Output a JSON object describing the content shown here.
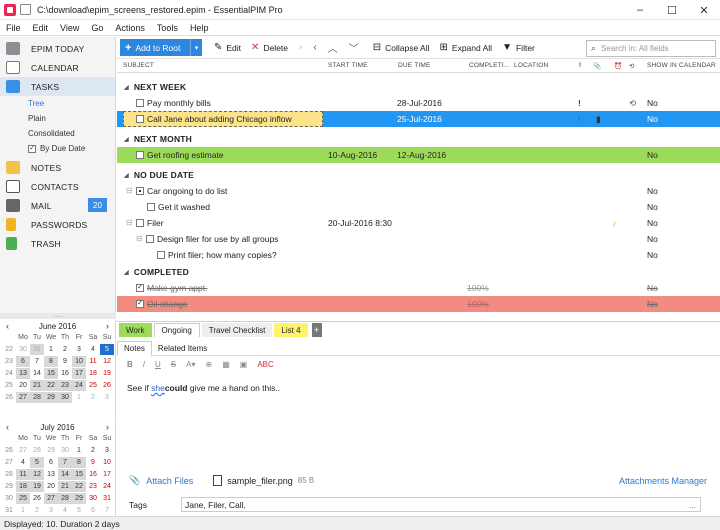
{
  "window": {
    "title": "C:\\download\\epim_screens_restored.epim - EssentialPIM Pro"
  },
  "menu": [
    "File",
    "Edit",
    "View",
    "Go",
    "Actions",
    "Tools",
    "Help"
  ],
  "sidebar": {
    "items": [
      {
        "label": "EPIM TODAY",
        "icon": "home-icon"
      },
      {
        "label": "CALENDAR",
        "icon": "calendar-icon"
      },
      {
        "label": "TASKS",
        "icon": "tasks-icon",
        "active": true
      },
      {
        "label": "NOTES",
        "icon": "notes-icon"
      },
      {
        "label": "CONTACTS",
        "icon": "contacts-icon"
      },
      {
        "label": "MAIL",
        "icon": "mail-icon",
        "badge": "20"
      },
      {
        "label": "PASSWORDS",
        "icon": "key-icon"
      },
      {
        "label": "TRASH",
        "icon": "trash-icon"
      }
    ],
    "task_views": [
      "Tree",
      "Plain",
      "Consolidated"
    ],
    "by_due_date": "By Due Date"
  },
  "calendar_june": {
    "title": "June  2016",
    "dayheads": [
      "Mo",
      "Tu",
      "We",
      "Th",
      "Fr",
      "Sa",
      "Su"
    ],
    "weeks": [
      {
        "wk": "22",
        "days": [
          "30",
          "31",
          "1",
          "2",
          "3",
          "4",
          "5"
        ]
      },
      {
        "wk": "23",
        "days": [
          "6",
          "7",
          "8",
          "9",
          "10",
          "11",
          "12"
        ]
      },
      {
        "wk": "24",
        "days": [
          "13",
          "14",
          "15",
          "16",
          "17",
          "18",
          "19"
        ]
      },
      {
        "wk": "25",
        "days": [
          "20",
          "21",
          "22",
          "23",
          "24",
          "25",
          "26"
        ]
      },
      {
        "wk": "26",
        "days": [
          "27",
          "28",
          "29",
          "30",
          "1",
          "2",
          "3"
        ]
      }
    ]
  },
  "calendar_july": {
    "title": "July  2016",
    "dayheads": [
      "Mo",
      "Tu",
      "We",
      "Th",
      "Fr",
      "Sa",
      "Su"
    ],
    "weeks": [
      {
        "wk": "26",
        "days": [
          "27",
          "28",
          "29",
          "30",
          "1",
          "2",
          "3"
        ]
      },
      {
        "wk": "27",
        "days": [
          "4",
          "5",
          "6",
          "7",
          "8",
          "9",
          "10"
        ]
      },
      {
        "wk": "28",
        "days": [
          "11",
          "12",
          "13",
          "14",
          "15",
          "16",
          "17"
        ]
      },
      {
        "wk": "29",
        "days": [
          "18",
          "19",
          "20",
          "21",
          "22",
          "23",
          "24"
        ]
      },
      {
        "wk": "30",
        "days": [
          "25",
          "26",
          "27",
          "28",
          "29",
          "30",
          "31"
        ]
      },
      {
        "wk": "31",
        "days": [
          "1",
          "2",
          "3",
          "4",
          "5",
          "6",
          "7"
        ]
      }
    ]
  },
  "toolbar": {
    "add": "Add to Root",
    "edit": "Edit",
    "delete": "Delete",
    "collapse": "Collapse All",
    "expand": "Expand All",
    "filter": "Filter",
    "search_placeholder": "Search in: All fields"
  },
  "columns": {
    "subject": "SUBJECT",
    "start": "START TIME",
    "due": "DUE TIME",
    "completion": "COMPLETI...",
    "location": "LOCATION",
    "show": "SHOW IN CALENDAR"
  },
  "groups": {
    "next_week": "NEXT WEEK",
    "next_month": "NEXT MONTH",
    "no_due": "NO DUE DATE",
    "completed": "COMPLETED"
  },
  "tasks": {
    "t1": {
      "subject": "Pay monthly bills",
      "due": "28-Jul-2016",
      "show": "No"
    },
    "t2": {
      "subject": "Call Jane about adding Chicago inflow",
      "due": "25-Jul-2016",
      "show": "No"
    },
    "t3": {
      "subject": "Get roofing estimate",
      "start": "10-Aug-2016",
      "due": "12-Aug-2016",
      "show": "No"
    },
    "t4": {
      "subject": "Car ongoing to do list",
      "show": "No"
    },
    "t5": {
      "subject": "Get it washed",
      "show": "No"
    },
    "t6": {
      "subject": "Filer",
      "start": "20-Jul-2016 8:30",
      "show": "No"
    },
    "t7": {
      "subject": "Design filer for use by all groups",
      "show": "No"
    },
    "t8": {
      "subject": "Print filer; how many copies?",
      "show": "No"
    },
    "t9": {
      "subject": "Make gym appt.",
      "pct": "100%",
      "show": "No"
    },
    "t10": {
      "subject": "Oil change",
      "pct": "100%",
      "show": "No"
    }
  },
  "lists": {
    "work": "Work",
    "ongoing": "Ongoing",
    "travel": "Travel Checklist",
    "list4": "List 4"
  },
  "notes": {
    "tab_notes": "Notes",
    "tab_related": "Related Items",
    "text_pre": "See if ",
    "text_she": "she",
    "text_could": "could",
    "text_post": " give me a hand on this.."
  },
  "attach": {
    "label": "Attach Files",
    "file": "sample_filer.png",
    "size": "85 B",
    "manager": "Attachments Manager"
  },
  "tags": {
    "label": "Tags",
    "value": "Jane, Filer, Call,"
  },
  "status": "Displayed: 10. Duration 2 days",
  "colors": {
    "accent": "#2e86de",
    "selected_row": "#2196f3",
    "green_row": "#9ddc5b",
    "red_row": "#f28b82"
  }
}
